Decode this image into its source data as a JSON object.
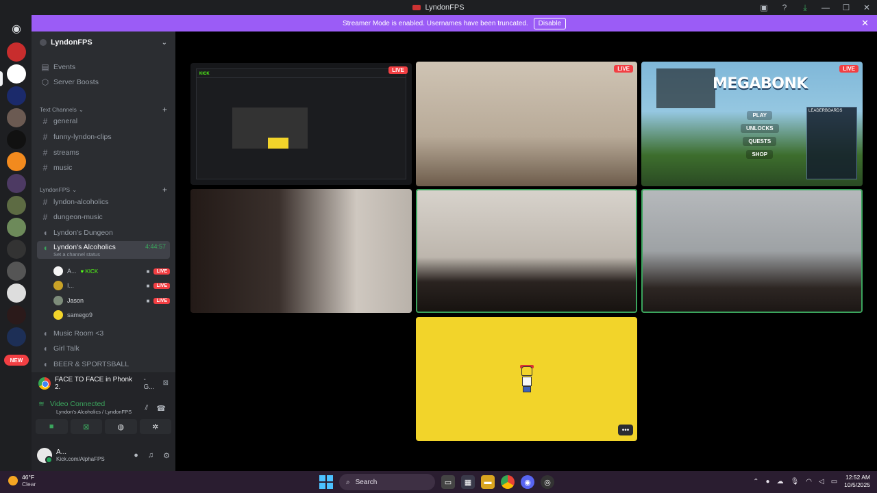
{
  "window": {
    "title": "LyndonFPS"
  },
  "banner": {
    "message": "Streamer Mode is enabled. Usernames have been truncated.",
    "disable_label": "Disable"
  },
  "server": {
    "name": "LyndonFPS"
  },
  "nav_items": [
    {
      "label": "Events"
    },
    {
      "label": "Server Boosts"
    }
  ],
  "categories": {
    "text": "Text Channels",
    "lyndon": "LyndonFPS"
  },
  "text_channels": [
    "general",
    "funny-lyndon-clips",
    "streams",
    "music"
  ],
  "lyndon_channels": [
    "lyndon-alcoholics",
    "dungeon-music",
    "Lyndon's Dungeon"
  ],
  "active_channel": {
    "name": "Lyndon's Alcoholics",
    "timer": "4:44:57",
    "status": "Set a channel status"
  },
  "voice_users": [
    {
      "name": "A...",
      "extra": "KICK",
      "live": "LIVE"
    },
    {
      "name": "I...",
      "extra": "",
      "live": "LIVE"
    },
    {
      "name": "Jason",
      "extra": "",
      "live": "LIVE"
    },
    {
      "name": "samego9",
      "extra": "",
      "live": ""
    }
  ],
  "more_channels": [
    "Music Room <3",
    "Girl Talk",
    "BEER & SPORTSBALL"
  ],
  "rail": {
    "new_badge": "NEW"
  },
  "activity": {
    "text": "FACE TO FACE in Phonk 2.",
    "suffix": "- G..."
  },
  "voice_panel": {
    "status": "Video Connected",
    "location": "Lyndon's Alcoholics / LyndonFPS"
  },
  "user": {
    "name": "A...",
    "status": "Kick.com/AlphaFPS"
  },
  "tiles": {
    "live_label": "LIVE",
    "game_title": "MEGABONK",
    "game_menu": [
      "PLAY",
      "UNLOCKS",
      "QUESTS",
      "SHOP"
    ],
    "leaderboard_title": "LEADERBOARDS"
  },
  "taskbar": {
    "temp": "46°F",
    "condition": "Clear",
    "search_placeholder": "Search",
    "time": "12:52 AM",
    "date": "10/5/2025"
  },
  "colors": {
    "accent": "#9b5cf6",
    "live": "#f23f43",
    "connected": "#3ba55d",
    "kick": "#53fc18"
  }
}
